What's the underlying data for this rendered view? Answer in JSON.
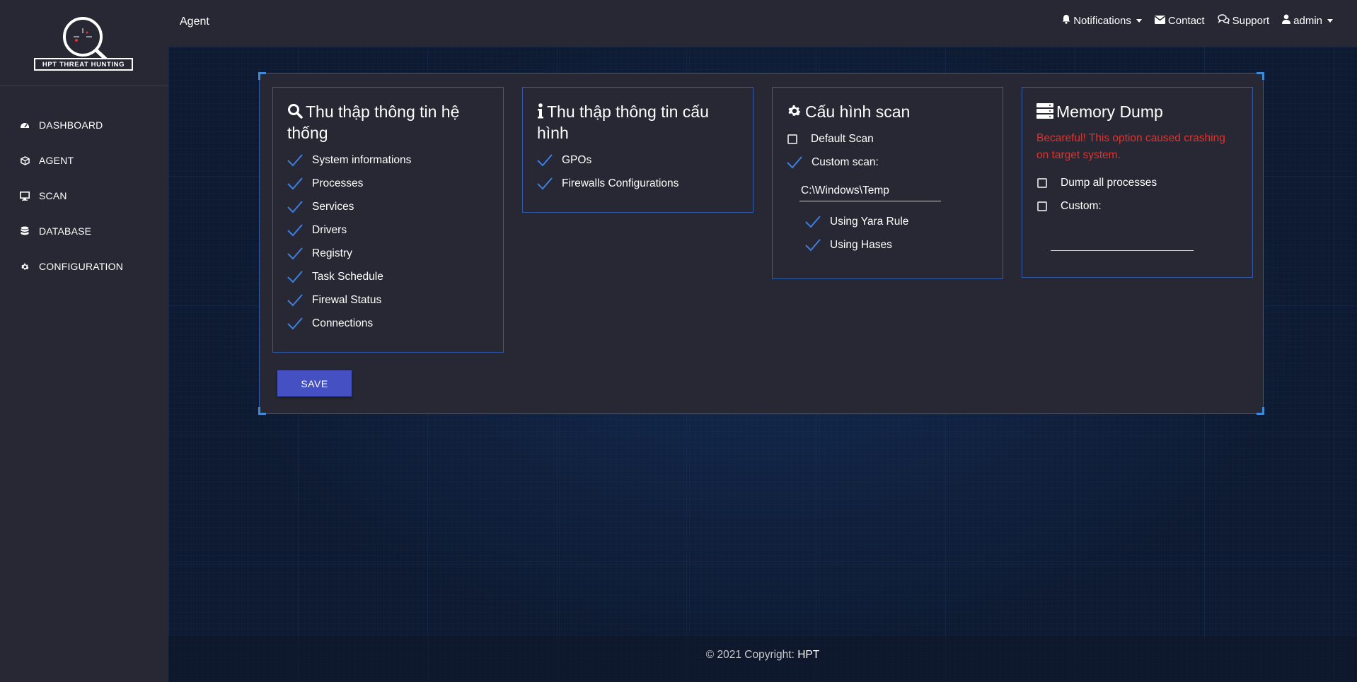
{
  "app": {
    "logo_text": "HPT THREAT HUNTING"
  },
  "sidebar": {
    "items": [
      {
        "label": "DASHBOARD",
        "icon": "dashboard-icon"
      },
      {
        "label": "AGENT",
        "icon": "cube-icon"
      },
      {
        "label": "SCAN",
        "icon": "monitor-icon"
      },
      {
        "label": "DATABASE",
        "icon": "database-icon"
      },
      {
        "label": "CONFIGURATION",
        "icon": "gear-icon"
      }
    ]
  },
  "header": {
    "title": "Agent",
    "notifications_label": "Notifications",
    "contact_label": "Contact",
    "support_label": "Support",
    "user_label": "admin"
  },
  "cards": {
    "system_info": {
      "title": "Thu thập thông tin hệ thống",
      "items": [
        "System informations",
        "Processes",
        "Services",
        "Drivers",
        "Registry",
        "Task Schedule",
        "Firewal Status",
        "Connections"
      ]
    },
    "config_info": {
      "title": "Thu thập thông tin cấu hình",
      "items": [
        "GPOs",
        "Firewalls Configurations"
      ]
    },
    "scan_config": {
      "title": "Cấu hình scan",
      "default_scan_label": "Default Scan",
      "default_scan_checked": false,
      "custom_scan_label": "Custom scan:",
      "custom_scan_checked": true,
      "custom_path": "C:\\Windows\\Temp",
      "yara_label": "Using Yara Rule",
      "hashes_label": "Using Hases"
    },
    "memory_dump": {
      "title": "Memory Dump",
      "warning": "Becareful! This option caused crashing on target system.",
      "dump_all_label": "Dump all processes",
      "custom_label": "Custom:",
      "custom_value": ""
    }
  },
  "actions": {
    "save_label": "SAVE"
  },
  "footer": {
    "copyright": "© 2021 Copyright:",
    "brand": "HPT"
  },
  "colors": {
    "accent": "#4550c2",
    "panel_border": "#2e5aa8",
    "check": "#3d7fe0",
    "warning": "#e2322f"
  }
}
